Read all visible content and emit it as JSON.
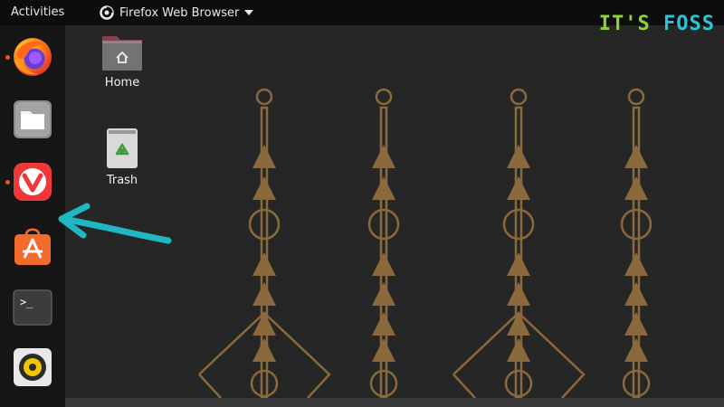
{
  "topbar": {
    "activities_label": "Activities",
    "app_name": "Firefox Web Browser"
  },
  "dock": {
    "items": [
      {
        "icon": "firefox-icon",
        "running": true
      },
      {
        "icon": "files-icon",
        "running": false
      },
      {
        "icon": "vivaldi-icon",
        "running": true
      },
      {
        "icon": "software-center-icon",
        "running": false
      },
      {
        "icon": "terminal-icon",
        "running": false
      },
      {
        "icon": "rhythmbox-icon",
        "running": false
      }
    ]
  },
  "desktop": {
    "icons": [
      {
        "label": "Home",
        "icon": "home-folder-icon"
      },
      {
        "label": "Trash",
        "icon": "trash-icon"
      }
    ]
  },
  "logo": {
    "part1": "IT'S",
    "part2": "FOSS"
  },
  "colors": {
    "topbar": "#0d0d0d",
    "dock": "#161616",
    "desktop": "#262626",
    "wallpaper_pattern": "#8a6a3c",
    "annotation_arrow": "#1fb8c2",
    "logo_green": "#8fd13b",
    "logo_cyan": "#26c6da",
    "running_indicator": "#e95420"
  }
}
